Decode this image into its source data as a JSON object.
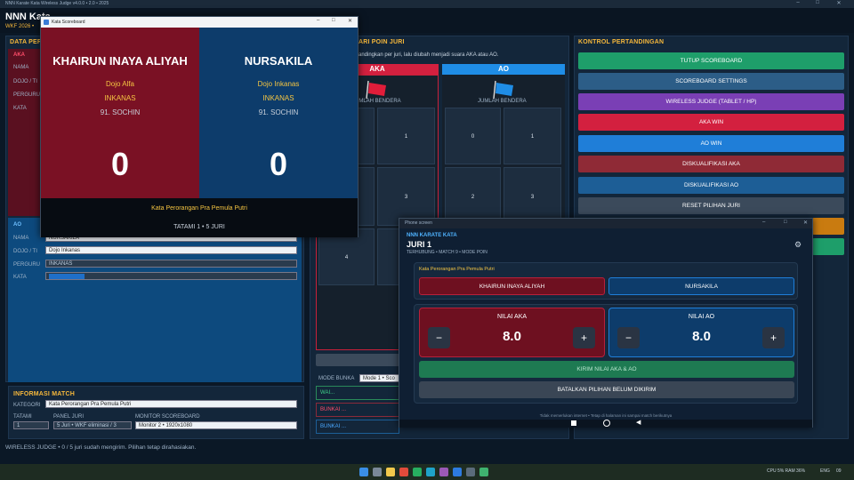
{
  "app": {
    "window_title": "NNN Karate Kata Wireless Judge v4.0.0 • 2.0 • 2025",
    "title": "NNN Kata",
    "subtitle": "WKF 2026 •",
    "status_bar": "WIRELESS JUDGE • 0 / 5 juri sudah mengirim. Pilihan tetap dirahasiakan."
  },
  "data_panel": {
    "title": "DATA PERT",
    "aka_label": "AKA",
    "ao_label": "AO",
    "labels": [
      "NAMA",
      "DOJO / TI",
      "PERGURU",
      "KATA"
    ],
    "ao_fields": [
      "NURSAKILA",
      "Dojo Inkanas",
      "INKANAS",
      ""
    ]
  },
  "info_match": {
    "title": "INFORMASI MATCH",
    "kategori_label": "KATEGORI",
    "kategori_value": "Kata Perorangan Pra Pemula Putri",
    "tatami_label": "TATAMI",
    "tatami_value": "1",
    "panel_label": "PANEL JURI",
    "panel_value": "5 Juri • WKF eliminasi / 3",
    "monitor_label": "MONITOR SCOREBOARD",
    "monitor_value": "Monitor 2 • 1920x1080"
  },
  "poin_panel": {
    "title": "ARI POIN JURI",
    "desc": "andingkan per juri, lalu diubah menjadi suara AKA atau AO.",
    "aka_header": "AKA",
    "ao_header": "AO",
    "aka_jumlah": "JUMLAH BENDERA",
    "ao_jumlah": "JUMLAH BENDERA",
    "aka_cells": [
      "",
      "1",
      "",
      "3",
      "4",
      ""
    ],
    "ao_cells": [
      "0",
      "1",
      "2",
      "3"
    ],
    "mode_label": "MODE BUNKA",
    "mode_value": "Mode 1 • Sco",
    "rows": [
      "WAI...",
      "BUNKAI ...",
      "BUNKAI ..."
    ]
  },
  "controls": {
    "title": "KONTROL PERTANDINGAN",
    "buttons": [
      {
        "label": "TUTUP SCOREBOARD",
        "color": "#1e9e6a"
      },
      {
        "label": "SCOREBOARD SETTINGS",
        "color": "#2c5d87"
      },
      {
        "label": "WIRELESS JUDGE (TABLET / HP)",
        "color": "#7a3fb5"
      },
      {
        "label": "AKA WIN",
        "color": "#d3203f"
      },
      {
        "label": "AO WIN",
        "color": "#1f7ed8"
      },
      {
        "label": "DISKUALIFIKASI AKA",
        "color": "#8f2a36"
      },
      {
        "label": "DISKUALIFIKASI AO",
        "color": "#1d5e96"
      },
      {
        "label": "RESET PILIHAN JURI",
        "color": "#3b4a5b"
      }
    ]
  },
  "scoreboard": {
    "window_title": "Kata Scoreboard",
    "aka": {
      "name": "KHAIRUN INAYA ALIYAH",
      "dojo": "Dojo Alfa",
      "kontingen": "INKANAS",
      "kata": "91. SOCHIN",
      "score": "0"
    },
    "ao": {
      "name": "NURSAKILA",
      "dojo": "Dojo Inkanas",
      "kontingen": "INKANAS",
      "kata": "91. SOCHIN",
      "score": "0"
    },
    "kategori": "Kata Perorangan Pra Pemula Putri",
    "tatami": "TATAMI 1 • 5 JURI"
  },
  "juri_window": {
    "window_title": "Phone screen",
    "brand": "NNN KARATE KATA",
    "juri": "JURI 1",
    "status": "TERHUBUNG • MATCH 9 • MODE POIN",
    "kategori": "Kata Perorangan Pra Pemula Putri",
    "aka_name": "KHAIRUN INAYA ALIYAH",
    "ao_name": "NURSAKILA",
    "nilai_aka_label": "NILAI AKA",
    "nilai_aka": "8.0",
    "nilai_ao_label": "NILAI AO",
    "nilai_ao": "8.0",
    "minus": "−",
    "plus": "+",
    "kirim": "KIRIM NILAI AKA & AO",
    "batal": "BATALKAN PILIHAN BELUM DIKIRIM",
    "footer": "Tidak memerlukan internet • Tetap di halaman ini sampai match berikutnya"
  },
  "taskbar": {
    "tray": "ENG",
    "time": "09",
    "stats": "CPU 5%  RAM 36%"
  }
}
